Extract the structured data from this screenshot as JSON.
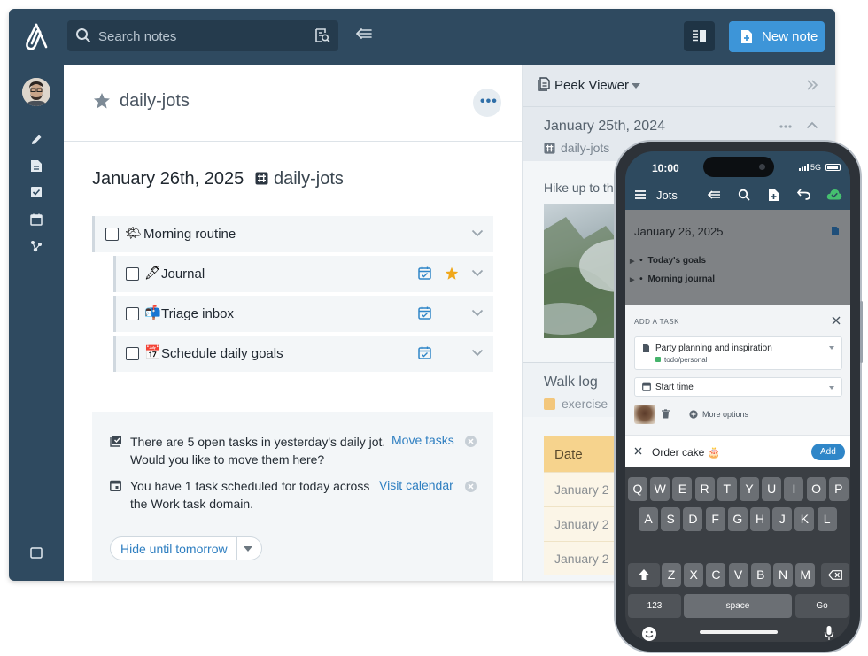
{
  "topbar": {
    "search_placeholder": "Search notes",
    "new_note_label": "New note"
  },
  "note": {
    "title": "daily-jots",
    "date_heading": "January 26th, 2025",
    "tag": "daily-jots"
  },
  "tasks": [
    {
      "emoji": "🌤",
      "label": "Morning routine"
    },
    {
      "emoji": "🖋",
      "label": "Journal"
    },
    {
      "emoji": "📬",
      "label": "Triage inbox"
    },
    {
      "emoji": "📅",
      "label": "Schedule daily goals"
    }
  ],
  "notices": [
    {
      "text": "There are 5 open tasks in yesterday's daily jot. Would you like to move them here?",
      "link": "Move tasks"
    },
    {
      "text": "You have 1 task scheduled for today across the Work task domain.",
      "link": "Visit calendar"
    }
  ],
  "hide_button": "Hide until tomorrow",
  "peek": {
    "title": "Peek Viewer",
    "card1_title": "January 25th, 2024",
    "card1_tag": "daily-jots",
    "card1_body": "Hike up to th",
    "card2_title": "Walk log",
    "card2_tag": "exercise",
    "table_header": "Date",
    "table_rows": [
      "January 2",
      "January 2",
      "January 2"
    ]
  },
  "phone": {
    "time": "10:00",
    "signal": "5G",
    "app_title": "Jots",
    "note_date": "January 26, 2025",
    "items": [
      "Today's goals",
      "Morning journal"
    ],
    "add_task_label": "ADD A TASK",
    "field1_label": "Party planning and inspiration",
    "field1_sub": "todo/personal",
    "field2_label": "Start time",
    "more_options": "More options",
    "input_value": "Order cake 🎂",
    "add_button": "Add",
    "keyboard": {
      "row1": [
        "Q",
        "W",
        "E",
        "R",
        "T",
        "Y",
        "U",
        "I",
        "O",
        "P"
      ],
      "row2": [
        "A",
        "S",
        "D",
        "F",
        "G",
        "H",
        "J",
        "K",
        "L"
      ],
      "row3": [
        "Z",
        "X",
        "C",
        "V",
        "B",
        "N",
        "M"
      ],
      "num_key": "123",
      "space_key": "space",
      "go_key": "Go"
    }
  }
}
